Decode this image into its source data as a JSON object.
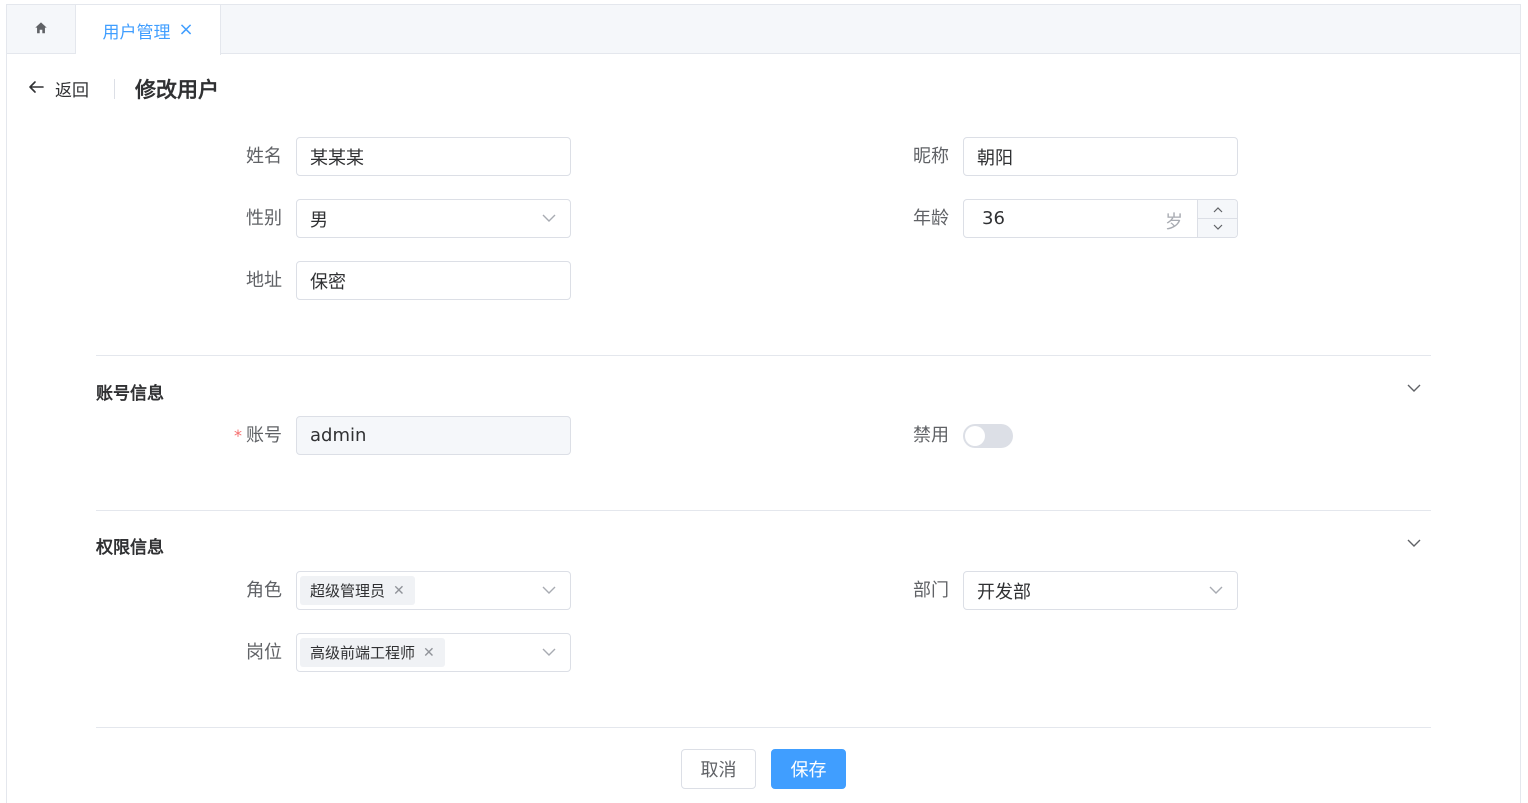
{
  "tabs": {
    "home_icon": "home-icon",
    "active_label": "用户管理",
    "close_icon": "close-icon"
  },
  "header": {
    "back_label": "返回",
    "title": "修改用户"
  },
  "basic": {
    "name": {
      "label": "姓名",
      "value": "某某某"
    },
    "nickname": {
      "label": "昵称",
      "value": "朝阳"
    },
    "gender": {
      "label": "性别",
      "value": "男"
    },
    "age": {
      "label": "年龄",
      "value": "36",
      "unit": "岁"
    },
    "address": {
      "label": "地址",
      "value": "保密"
    }
  },
  "account": {
    "section_title": "账号信息",
    "required_mark": "*",
    "account": {
      "label": "账号",
      "value": "admin"
    },
    "disabled": {
      "label": "禁用",
      "value": false
    }
  },
  "permission": {
    "section_title": "权限信息",
    "role": {
      "label": "角色",
      "tags": [
        "超级管理员"
      ]
    },
    "department": {
      "label": "部门",
      "value": "开发部"
    },
    "position": {
      "label": "岗位",
      "tags": [
        "高级前端工程师"
      ]
    }
  },
  "actions": {
    "cancel_label": "取消",
    "save_label": "保存"
  },
  "colors": {
    "primary": "#409eff",
    "required": "#f56c6c",
    "border": "#dcdfe6"
  }
}
